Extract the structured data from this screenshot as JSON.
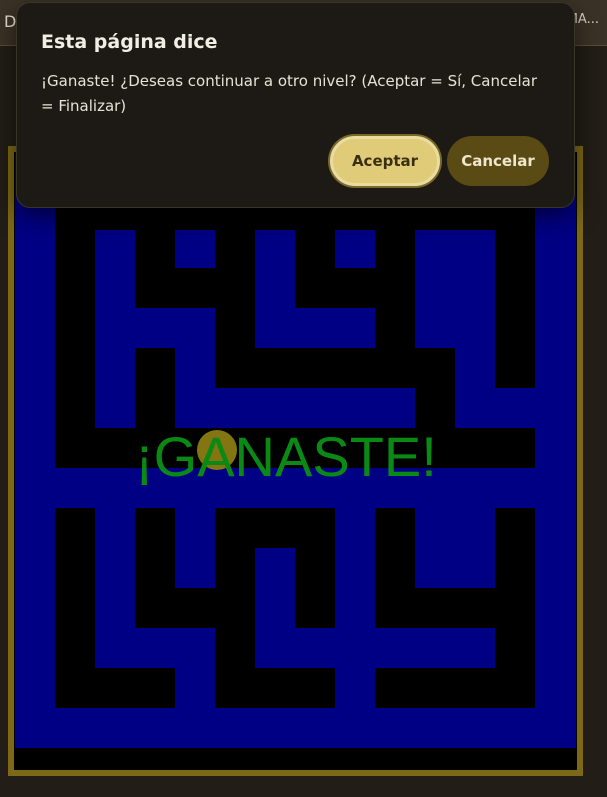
{
  "browser": {
    "tab_left": "D",
    "tab_right": "MA..."
  },
  "game": {
    "win_text": "¡GANASTE!",
    "colors": {
      "wall": "#000084",
      "path": "#000000",
      "frame": "#7d6817",
      "player": "#8a7b12",
      "win_text": "#0a8a14"
    }
  },
  "dialog": {
    "title": "Esta página dice",
    "message": "¡Ganaste! ¿Deseas continuar a otro nivel? (Aceptar = Sí, Cancelar = Finalizar)",
    "accept_label": "Aceptar",
    "cancel_label": "Cancelar"
  }
}
